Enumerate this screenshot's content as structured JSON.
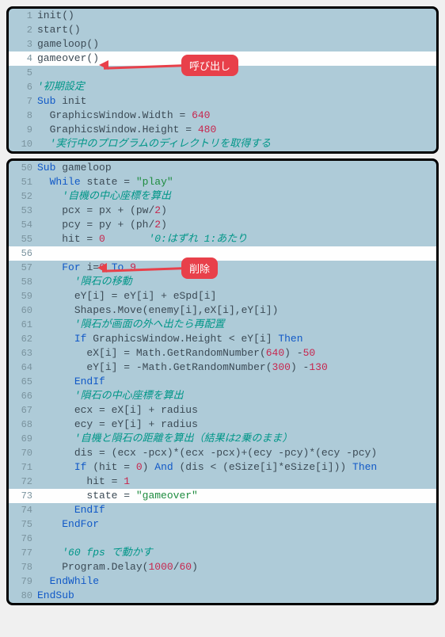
{
  "badges": {
    "call": "呼び出し",
    "delete": "削除"
  },
  "block1": [
    {
      "n": 1,
      "hl": false,
      "tokens": [
        {
          "t": "id",
          "v": "init"
        },
        {
          "t": "op",
          "v": "()"
        }
      ]
    },
    {
      "n": 2,
      "hl": false,
      "tokens": [
        {
          "t": "id",
          "v": "start"
        },
        {
          "t": "op",
          "v": "()"
        }
      ]
    },
    {
      "n": 3,
      "hl": false,
      "tokens": [
        {
          "t": "id",
          "v": "gameloop"
        },
        {
          "t": "op",
          "v": "()"
        }
      ]
    },
    {
      "n": 4,
      "hl": true,
      "tokens": [
        {
          "t": "id",
          "v": "gameover"
        },
        {
          "t": "op",
          "v": "()"
        }
      ]
    },
    {
      "n": 5,
      "hl": false,
      "tokens": []
    },
    {
      "n": 6,
      "hl": false,
      "tokens": [
        {
          "t": "cmt",
          "v": "'初期設定"
        }
      ]
    },
    {
      "n": 7,
      "hl": false,
      "tokens": [
        {
          "t": "kw",
          "v": "Sub"
        },
        {
          "t": "op",
          "v": " "
        },
        {
          "t": "id",
          "v": "init"
        }
      ]
    },
    {
      "n": 8,
      "hl": false,
      "tokens": [
        {
          "t": "op",
          "v": "  "
        },
        {
          "t": "id",
          "v": "GraphicsWindow"
        },
        {
          "t": "op",
          "v": "."
        },
        {
          "t": "id",
          "v": "Width"
        },
        {
          "t": "op",
          "v": " = "
        },
        {
          "t": "num",
          "v": "640"
        }
      ]
    },
    {
      "n": 9,
      "hl": false,
      "tokens": [
        {
          "t": "op",
          "v": "  "
        },
        {
          "t": "id",
          "v": "GraphicsWindow"
        },
        {
          "t": "op",
          "v": "."
        },
        {
          "t": "id",
          "v": "Height"
        },
        {
          "t": "op",
          "v": " = "
        },
        {
          "t": "num",
          "v": "480"
        }
      ]
    },
    {
      "n": 10,
      "hl": false,
      "tokens": [
        {
          "t": "op",
          "v": "  "
        },
        {
          "t": "cmt",
          "v": "'実行中のプログラムのディレクトリを取得する"
        }
      ]
    }
  ],
  "block2": [
    {
      "n": 50,
      "hl": false,
      "tokens": [
        {
          "t": "kw",
          "v": "Sub"
        },
        {
          "t": "op",
          "v": " "
        },
        {
          "t": "id",
          "v": "gameloop"
        }
      ]
    },
    {
      "n": 51,
      "hl": false,
      "tokens": [
        {
          "t": "op",
          "v": "  "
        },
        {
          "t": "kw",
          "v": "While"
        },
        {
          "t": "op",
          "v": " "
        },
        {
          "t": "id",
          "v": "state"
        },
        {
          "t": "op",
          "v": " = "
        },
        {
          "t": "str",
          "v": "\"play\""
        }
      ]
    },
    {
      "n": 52,
      "hl": false,
      "tokens": [
        {
          "t": "op",
          "v": "    "
        },
        {
          "t": "cmt",
          "v": "'自機の中心座標を算出"
        }
      ]
    },
    {
      "n": 53,
      "hl": false,
      "tokens": [
        {
          "t": "op",
          "v": "    "
        },
        {
          "t": "id",
          "v": "pcx"
        },
        {
          "t": "op",
          "v": " = "
        },
        {
          "t": "id",
          "v": "px"
        },
        {
          "t": "op",
          "v": " + ("
        },
        {
          "t": "id",
          "v": "pw"
        },
        {
          "t": "op",
          "v": "/"
        },
        {
          "t": "num",
          "v": "2"
        },
        {
          "t": "op",
          "v": ")"
        }
      ]
    },
    {
      "n": 54,
      "hl": false,
      "tokens": [
        {
          "t": "op",
          "v": "    "
        },
        {
          "t": "id",
          "v": "pcy"
        },
        {
          "t": "op",
          "v": " = "
        },
        {
          "t": "id",
          "v": "py"
        },
        {
          "t": "op",
          "v": " + ("
        },
        {
          "t": "id",
          "v": "ph"
        },
        {
          "t": "op",
          "v": "/"
        },
        {
          "t": "num",
          "v": "2"
        },
        {
          "t": "op",
          "v": ")"
        }
      ]
    },
    {
      "n": 55,
      "hl": false,
      "tokens": [
        {
          "t": "op",
          "v": "    "
        },
        {
          "t": "id",
          "v": "hit"
        },
        {
          "t": "op",
          "v": " = "
        },
        {
          "t": "num",
          "v": "0"
        },
        {
          "t": "op",
          "v": "       "
        },
        {
          "t": "cmt",
          "v": "'0:はずれ 1:あたり"
        }
      ]
    },
    {
      "n": 56,
      "hl": true,
      "tokens": []
    },
    {
      "n": 57,
      "hl": false,
      "tokens": [
        {
          "t": "op",
          "v": "    "
        },
        {
          "t": "kw",
          "v": "For"
        },
        {
          "t": "op",
          "v": " "
        },
        {
          "t": "id",
          "v": "i"
        },
        {
          "t": "op",
          "v": "="
        },
        {
          "t": "num",
          "v": "0"
        },
        {
          "t": "op",
          "v": " "
        },
        {
          "t": "kw",
          "v": "To"
        },
        {
          "t": "op",
          "v": " "
        },
        {
          "t": "num",
          "v": "9"
        }
      ]
    },
    {
      "n": 58,
      "hl": false,
      "tokens": [
        {
          "t": "op",
          "v": "      "
        },
        {
          "t": "cmt",
          "v": "'隕石の移動"
        }
      ]
    },
    {
      "n": 59,
      "hl": false,
      "tokens": [
        {
          "t": "op",
          "v": "      "
        },
        {
          "t": "id",
          "v": "eY"
        },
        {
          "t": "op",
          "v": "["
        },
        {
          "t": "id",
          "v": "i"
        },
        {
          "t": "op",
          "v": "] = "
        },
        {
          "t": "id",
          "v": "eY"
        },
        {
          "t": "op",
          "v": "["
        },
        {
          "t": "id",
          "v": "i"
        },
        {
          "t": "op",
          "v": "] + "
        },
        {
          "t": "id",
          "v": "eSpd"
        },
        {
          "t": "op",
          "v": "["
        },
        {
          "t": "id",
          "v": "i"
        },
        {
          "t": "op",
          "v": "]"
        }
      ]
    },
    {
      "n": 60,
      "hl": false,
      "tokens": [
        {
          "t": "op",
          "v": "      "
        },
        {
          "t": "id",
          "v": "Shapes"
        },
        {
          "t": "op",
          "v": "."
        },
        {
          "t": "id",
          "v": "Move"
        },
        {
          "t": "op",
          "v": "("
        },
        {
          "t": "id",
          "v": "enemy"
        },
        {
          "t": "op",
          "v": "["
        },
        {
          "t": "id",
          "v": "i"
        },
        {
          "t": "op",
          "v": "],"
        },
        {
          "t": "id",
          "v": "eX"
        },
        {
          "t": "op",
          "v": "["
        },
        {
          "t": "id",
          "v": "i"
        },
        {
          "t": "op",
          "v": "],"
        },
        {
          "t": "id",
          "v": "eY"
        },
        {
          "t": "op",
          "v": "["
        },
        {
          "t": "id",
          "v": "i"
        },
        {
          "t": "op",
          "v": "])"
        }
      ]
    },
    {
      "n": 61,
      "hl": false,
      "tokens": [
        {
          "t": "op",
          "v": "      "
        },
        {
          "t": "cmt",
          "v": "'隕石が画面の外へ出たら再配置"
        }
      ]
    },
    {
      "n": 62,
      "hl": false,
      "tokens": [
        {
          "t": "op",
          "v": "      "
        },
        {
          "t": "kw",
          "v": "If"
        },
        {
          "t": "op",
          "v": " "
        },
        {
          "t": "id",
          "v": "GraphicsWindow"
        },
        {
          "t": "op",
          "v": "."
        },
        {
          "t": "id",
          "v": "Height"
        },
        {
          "t": "op",
          "v": " < "
        },
        {
          "t": "id",
          "v": "eY"
        },
        {
          "t": "op",
          "v": "["
        },
        {
          "t": "id",
          "v": "i"
        },
        {
          "t": "op",
          "v": "] "
        },
        {
          "t": "kw",
          "v": "Then"
        }
      ]
    },
    {
      "n": 63,
      "hl": false,
      "tokens": [
        {
          "t": "op",
          "v": "        "
        },
        {
          "t": "id",
          "v": "eX"
        },
        {
          "t": "op",
          "v": "["
        },
        {
          "t": "id",
          "v": "i"
        },
        {
          "t": "op",
          "v": "] = "
        },
        {
          "t": "id",
          "v": "Math"
        },
        {
          "t": "op",
          "v": "."
        },
        {
          "t": "id",
          "v": "GetRandomNumber"
        },
        {
          "t": "op",
          "v": "("
        },
        {
          "t": "num",
          "v": "640"
        },
        {
          "t": "op",
          "v": ") -"
        },
        {
          "t": "num",
          "v": "50"
        }
      ]
    },
    {
      "n": 64,
      "hl": false,
      "tokens": [
        {
          "t": "op",
          "v": "        "
        },
        {
          "t": "id",
          "v": "eY"
        },
        {
          "t": "op",
          "v": "["
        },
        {
          "t": "id",
          "v": "i"
        },
        {
          "t": "op",
          "v": "] = -"
        },
        {
          "t": "id",
          "v": "Math"
        },
        {
          "t": "op",
          "v": "."
        },
        {
          "t": "id",
          "v": "GetRandomNumber"
        },
        {
          "t": "op",
          "v": "("
        },
        {
          "t": "num",
          "v": "300"
        },
        {
          "t": "op",
          "v": ") -"
        },
        {
          "t": "num",
          "v": "130"
        }
      ]
    },
    {
      "n": 65,
      "hl": false,
      "tokens": [
        {
          "t": "op",
          "v": "      "
        },
        {
          "t": "kw",
          "v": "EndIf"
        }
      ]
    },
    {
      "n": 66,
      "hl": false,
      "tokens": [
        {
          "t": "op",
          "v": "      "
        },
        {
          "t": "cmt",
          "v": "'隕石の中心座標を算出"
        }
      ]
    },
    {
      "n": 67,
      "hl": false,
      "tokens": [
        {
          "t": "op",
          "v": "      "
        },
        {
          "t": "id",
          "v": "ecx"
        },
        {
          "t": "op",
          "v": " = "
        },
        {
          "t": "id",
          "v": "eX"
        },
        {
          "t": "op",
          "v": "["
        },
        {
          "t": "id",
          "v": "i"
        },
        {
          "t": "op",
          "v": "] + "
        },
        {
          "t": "id",
          "v": "radius"
        }
      ]
    },
    {
      "n": 68,
      "hl": false,
      "tokens": [
        {
          "t": "op",
          "v": "      "
        },
        {
          "t": "id",
          "v": "ecy"
        },
        {
          "t": "op",
          "v": " = "
        },
        {
          "t": "id",
          "v": "eY"
        },
        {
          "t": "op",
          "v": "["
        },
        {
          "t": "id",
          "v": "i"
        },
        {
          "t": "op",
          "v": "] + "
        },
        {
          "t": "id",
          "v": "radius"
        }
      ]
    },
    {
      "n": 69,
      "hl": false,
      "tokens": [
        {
          "t": "op",
          "v": "      "
        },
        {
          "t": "cmt",
          "v": "'自機と隕石の距離を算出（結果は2乗のまま）"
        }
      ]
    },
    {
      "n": 70,
      "hl": false,
      "tokens": [
        {
          "t": "op",
          "v": "      "
        },
        {
          "t": "id",
          "v": "dis"
        },
        {
          "t": "op",
          "v": " = ("
        },
        {
          "t": "id",
          "v": "ecx"
        },
        {
          "t": "op",
          "v": " -"
        },
        {
          "t": "id",
          "v": "pcx"
        },
        {
          "t": "op",
          "v": ")*("
        },
        {
          "t": "id",
          "v": "ecx"
        },
        {
          "t": "op",
          "v": " -"
        },
        {
          "t": "id",
          "v": "pcx"
        },
        {
          "t": "op",
          "v": ")+("
        },
        {
          "t": "id",
          "v": "ecy"
        },
        {
          "t": "op",
          "v": " -"
        },
        {
          "t": "id",
          "v": "pcy"
        },
        {
          "t": "op",
          "v": ")*("
        },
        {
          "t": "id",
          "v": "ecy"
        },
        {
          "t": "op",
          "v": " -"
        },
        {
          "t": "id",
          "v": "pcy"
        },
        {
          "t": "op",
          "v": ")"
        }
      ]
    },
    {
      "n": 71,
      "hl": false,
      "tokens": [
        {
          "t": "op",
          "v": "      "
        },
        {
          "t": "kw",
          "v": "If"
        },
        {
          "t": "op",
          "v": " ("
        },
        {
          "t": "id",
          "v": "hit"
        },
        {
          "t": "op",
          "v": " = "
        },
        {
          "t": "num",
          "v": "0"
        },
        {
          "t": "op",
          "v": ") "
        },
        {
          "t": "kw",
          "v": "And"
        },
        {
          "t": "op",
          "v": " ("
        },
        {
          "t": "id",
          "v": "dis"
        },
        {
          "t": "op",
          "v": " < ("
        },
        {
          "t": "id",
          "v": "eSize"
        },
        {
          "t": "op",
          "v": "["
        },
        {
          "t": "id",
          "v": "i"
        },
        {
          "t": "op",
          "v": "]*"
        },
        {
          "t": "id",
          "v": "eSize"
        },
        {
          "t": "op",
          "v": "["
        },
        {
          "t": "id",
          "v": "i"
        },
        {
          "t": "op",
          "v": "])) "
        },
        {
          "t": "kw",
          "v": "Then"
        }
      ]
    },
    {
      "n": 72,
      "hl": false,
      "tokens": [
        {
          "t": "op",
          "v": "        "
        },
        {
          "t": "id",
          "v": "hit"
        },
        {
          "t": "op",
          "v": " = "
        },
        {
          "t": "num",
          "v": "1"
        }
      ]
    },
    {
      "n": 73,
      "hl": true,
      "tokens": [
        {
          "t": "op",
          "v": "        "
        },
        {
          "t": "id",
          "v": "state"
        },
        {
          "t": "op",
          "v": " = "
        },
        {
          "t": "str",
          "v": "\"gameover\""
        }
      ]
    },
    {
      "n": 74,
      "hl": false,
      "tokens": [
        {
          "t": "op",
          "v": "      "
        },
        {
          "t": "kw",
          "v": "EndIf"
        }
      ]
    },
    {
      "n": 75,
      "hl": false,
      "tokens": [
        {
          "t": "op",
          "v": "    "
        },
        {
          "t": "kw",
          "v": "EndFor"
        }
      ]
    },
    {
      "n": 76,
      "hl": false,
      "tokens": []
    },
    {
      "n": 77,
      "hl": false,
      "tokens": [
        {
          "t": "op",
          "v": "    "
        },
        {
          "t": "cmt",
          "v": "'60 fps で動かす"
        }
      ]
    },
    {
      "n": 78,
      "hl": false,
      "tokens": [
        {
          "t": "op",
          "v": "    "
        },
        {
          "t": "id",
          "v": "Program"
        },
        {
          "t": "op",
          "v": "."
        },
        {
          "t": "id",
          "v": "Delay"
        },
        {
          "t": "op",
          "v": "("
        },
        {
          "t": "num",
          "v": "1000"
        },
        {
          "t": "op",
          "v": "/"
        },
        {
          "t": "num",
          "v": "60"
        },
        {
          "t": "op",
          "v": ")"
        }
      ]
    },
    {
      "n": 79,
      "hl": false,
      "tokens": [
        {
          "t": "op",
          "v": "  "
        },
        {
          "t": "kw",
          "v": "EndWhile"
        }
      ]
    },
    {
      "n": 80,
      "hl": false,
      "tokens": [
        {
          "t": "kw",
          "v": "EndSub"
        }
      ]
    }
  ]
}
